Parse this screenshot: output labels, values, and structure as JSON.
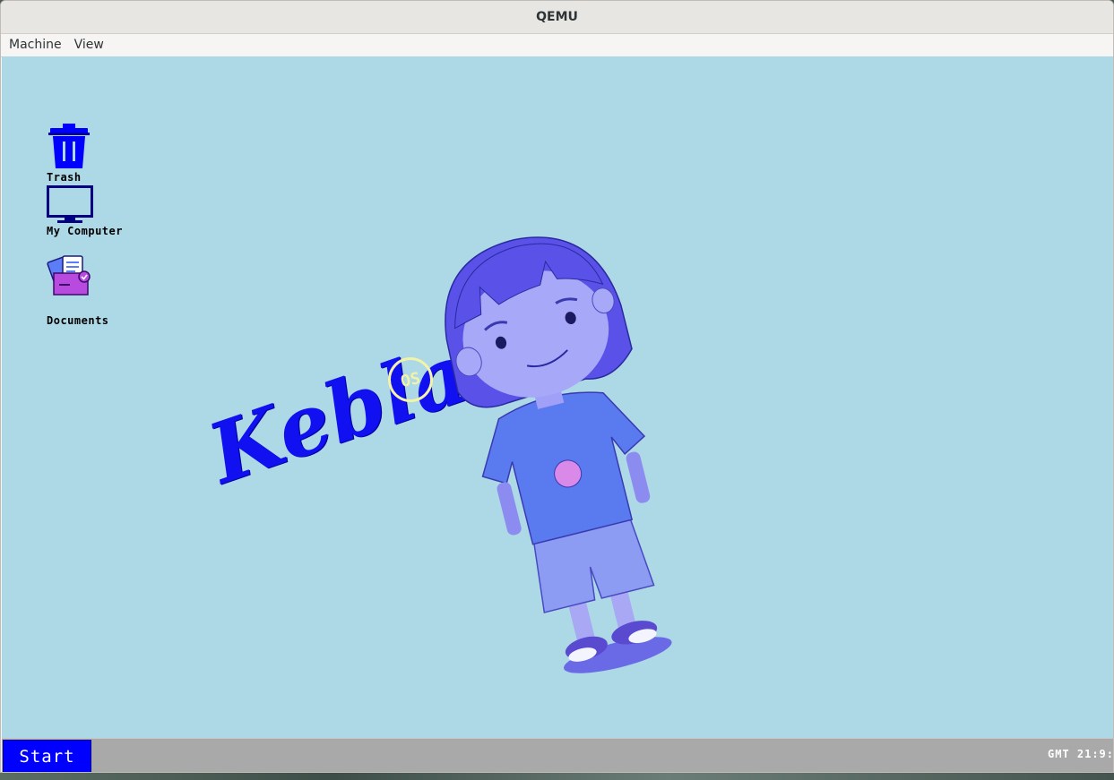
{
  "window": {
    "title": "QEMU"
  },
  "menubar": {
    "items": [
      "Machine",
      "View"
    ]
  },
  "desktop": {
    "background_color": "#add8e6",
    "icons": [
      {
        "label": "Trash",
        "icon": "trash-icon"
      },
      {
        "label": "My Computer",
        "icon": "monitor-icon"
      },
      {
        "label": "Documents",
        "icon": "documents-folder-icon"
      }
    ],
    "wallpaper": {
      "logo_text": "Kebla",
      "logo_badge": "OS",
      "logo_color": "#1010f0",
      "badge_color": "#f2f2a8",
      "character": "cartoon-child-illustration"
    }
  },
  "taskbar": {
    "start_label": "Start",
    "clock": "GMT  21:9:",
    "background_color": "#a9a9a9",
    "start_color": "#0000ff"
  }
}
